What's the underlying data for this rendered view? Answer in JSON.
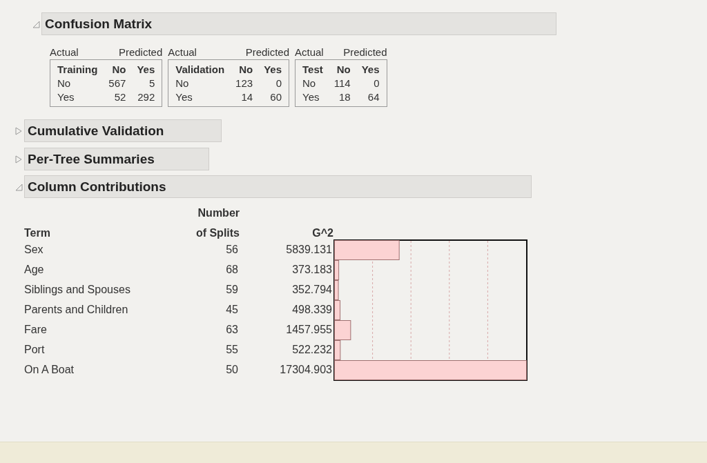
{
  "sections": [
    {
      "kind": "confusion",
      "title": "Confusion Matrix",
      "expanded": true,
      "matrices": [
        {
          "actual_label": "Actual",
          "predicted_label": "Predicted",
          "columns": [
            "Training",
            "No",
            "Yes"
          ],
          "rows": [
            [
              "No",
              "567",
              "5"
            ],
            [
              "Yes",
              "52",
              "292"
            ]
          ]
        },
        {
          "actual_label": "Actual",
          "predicted_label": "Predicted",
          "columns": [
            "Validation",
            "No",
            "Yes"
          ],
          "rows": [
            [
              "No",
              "123",
              "0"
            ],
            [
              "Yes",
              "14",
              "60"
            ]
          ]
        },
        {
          "actual_label": "Actual",
          "predicted_label": "Predicted",
          "columns": [
            "Test",
            "No",
            "Yes"
          ],
          "rows": [
            [
              "No",
              "114",
              "0"
            ],
            [
              "Yes",
              "18",
              "64"
            ]
          ]
        }
      ]
    },
    {
      "kind": "collapsed",
      "title": "Cumulative Validation",
      "expanded": false
    },
    {
      "kind": "collapsed",
      "title": "Per-Tree Summaries",
      "expanded": false
    },
    {
      "kind": "contributions",
      "title": "Column Contributions",
      "expanded": true,
      "columns": [
        "Term",
        "Number",
        "of Splits",
        "G^2"
      ],
      "rows": [
        {
          "term": "Sex",
          "splits": "56",
          "g2": "5839.131",
          "level": 0.337
        },
        {
          "term": "Age",
          "splits": "68",
          "g2": "373.183",
          "level": 0.022
        },
        {
          "term": "Siblings and Spouses",
          "splits": "59",
          "g2": "352.794",
          "level": 0.02
        },
        {
          "term": "Parents and Children",
          "splits": "45",
          "g2": "498.339",
          "level": 0.029
        },
        {
          "term": "Fare",
          "splits": "63",
          "g2": "1457.955",
          "level": 0.084
        },
        {
          "term": "Port",
          "splits": "55",
          "g2": "522.232",
          "level": 0.03
        },
        {
          "term": "On A Boat",
          "splits": "50",
          "g2": "17304.903",
          "level": 1.0
        }
      ]
    }
  ]
}
